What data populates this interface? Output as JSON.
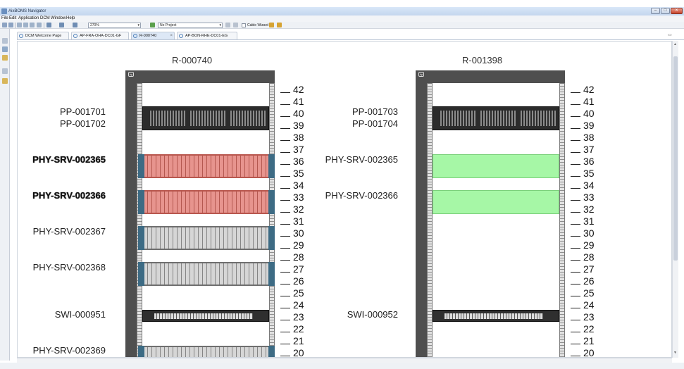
{
  "window": {
    "title": "AixBOMS Navigator",
    "min_label": "–",
    "max_label": "□",
    "close_label": "✕"
  },
  "menu": {
    "items": [
      "File",
      "Edit",
      "Application",
      "DCM",
      "Window",
      "Help"
    ]
  },
  "toolbar": {
    "zoom": "270%",
    "project": "No Project",
    "cable_wizard": "Cable Wizard"
  },
  "tabs": [
    {
      "label": "DCM Welcome Page"
    },
    {
      "label": "AP-FRA-OHA-DC01-GF"
    },
    {
      "label": "R-000740"
    },
    {
      "label": "AP-BON-RHE-DC01-EG"
    }
  ],
  "racks": [
    {
      "name": "R-000740",
      "labels": [
        "PP-001701",
        "PP-001702",
        "PHY-SRV-002365",
        "PHY-SRV-002366",
        "PHY-SRV-002367",
        "PHY-SRV-002368",
        "SWI-000951",
        "PHY-SRV-002369"
      ]
    },
    {
      "name": "R-001398",
      "labels": [
        "PP-001703",
        "PP-001704",
        "PHY-SRV-002365",
        "PHY-SRV-002366",
        "SWI-000952"
      ]
    }
  ],
  "rack_units": [
    "42",
    "41",
    "40",
    "39",
    "38",
    "37",
    "36",
    "35",
    "34",
    "33",
    "32",
    "31",
    "30",
    "29",
    "28",
    "27",
    "26",
    "25",
    "24",
    "23",
    "22",
    "21",
    "20"
  ],
  "colors": {
    "highlight_red": "#e7948e",
    "highlight_green": "#a6f7a6",
    "rack_frame": "#4f4f4f"
  }
}
